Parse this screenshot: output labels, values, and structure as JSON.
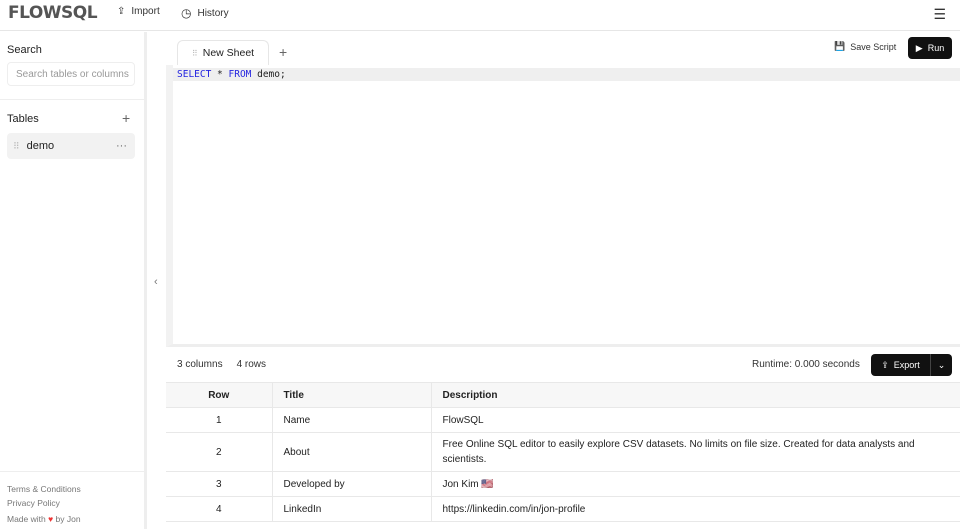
{
  "header": {
    "logo": "FLOWSQL",
    "import": "Import",
    "history": "History"
  },
  "sidebar": {
    "search_title": "Search",
    "search_placeholder": "Search tables or columns",
    "tables_title": "Tables",
    "tables": [
      {
        "name": "demo"
      }
    ],
    "footer": {
      "terms": "Terms & Conditions",
      "privacy": "Privacy Policy",
      "made_with": "Made with",
      "by": "by Jon"
    }
  },
  "editor": {
    "tab": "New Sheet",
    "save": "Save Script",
    "run": "Run",
    "query": {
      "kw1": "SELECT",
      "star": " * ",
      "kw2": "FROM",
      "rest": " demo;"
    }
  },
  "results": {
    "columns": "3 columns",
    "rows": "4 rows",
    "runtime": "Runtime: 0.000 seconds",
    "export": "Export",
    "headers": [
      "Row",
      "Title",
      "Description"
    ],
    "data": [
      [
        "1",
        "Name",
        "FlowSQL"
      ],
      [
        "2",
        "About",
        "Free Online SQL editor to easily explore CSV datasets. No limits on file size. Created for data analysts and scientists."
      ],
      [
        "3",
        "Developed by",
        "Jon Kim 🇺🇸"
      ],
      [
        "4",
        "LinkedIn",
        "https://linkedin.com/in/jon-profile"
      ]
    ]
  }
}
